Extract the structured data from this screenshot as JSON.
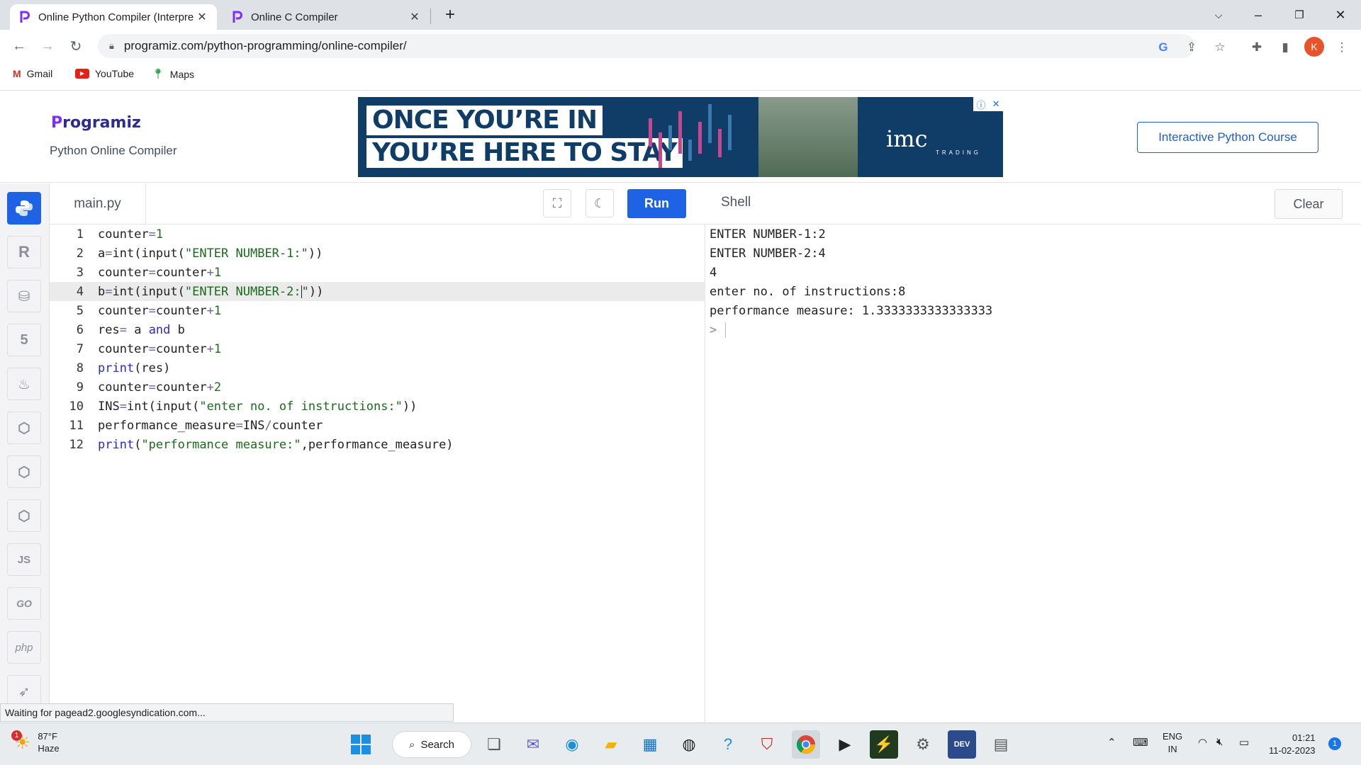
{
  "browser": {
    "tabs": [
      {
        "title": "Online Python Compiler (Interpre",
        "active": true
      },
      {
        "title": "Online C Compiler",
        "active": false
      }
    ],
    "url": "programiz.com/python-programming/online-compiler/",
    "profile_initial": "K",
    "bookmarks": [
      {
        "label": "Gmail",
        "icon": "gmail-icon"
      },
      {
        "label": "YouTube",
        "icon": "youtube-icon"
      },
      {
        "label": "Maps",
        "icon": "maps-icon"
      }
    ]
  },
  "site": {
    "logo": "rogramiz",
    "logo_initial": "P",
    "subtitle": "Python Online Compiler",
    "course_button": "Interactive Python Course"
  },
  "ad": {
    "line1": "ONCE YOU’RE IN",
    "line2": "YOU’RE HERE TO STAY",
    "brand": "imc",
    "brand_sub": "TRADING"
  },
  "sidebar": {
    "items": [
      "python",
      "r",
      "sql",
      "html",
      "java",
      "c",
      "cpp",
      "csharp",
      "JS",
      "GO",
      "php",
      "swift"
    ]
  },
  "editor": {
    "filename": "main.py",
    "run_label": "Run",
    "highlight_line": 4,
    "lines": [
      "counter=1",
      "a=int(input(\"ENTER NUMBER-1:\"))",
      "counter=counter+1",
      "b=int(input(\"ENTER NUMBER-2:\"))",
      "counter=counter+1",
      "res= a and b",
      "counter=counter+1",
      "print(res)",
      "counter=counter+2",
      "INS=int(input(\"enter no. of instructions:\"))",
      "performance_measure=INS/counter",
      "print(\"performance measure:\",performance_measure)"
    ]
  },
  "shell": {
    "title": "Shell",
    "clear_label": "Clear",
    "output": [
      "ENTER NUMBER-1:2",
      "ENTER NUMBER-2:4",
      "4",
      "enter no. of instructions:8",
      "performance measure: 1.3333333333333333"
    ],
    "prompt": ">"
  },
  "status": {
    "text": "Waiting for pagead2.googlesyndication.com..."
  },
  "taskbar": {
    "weather_temp": "87°F",
    "weather_desc": "Haze",
    "weather_badge": "1",
    "search_label": "Search",
    "lang_top": "ENG",
    "lang_bottom": "IN",
    "time": "01:21",
    "date": "11-02-2023",
    "notif_count": "1"
  }
}
